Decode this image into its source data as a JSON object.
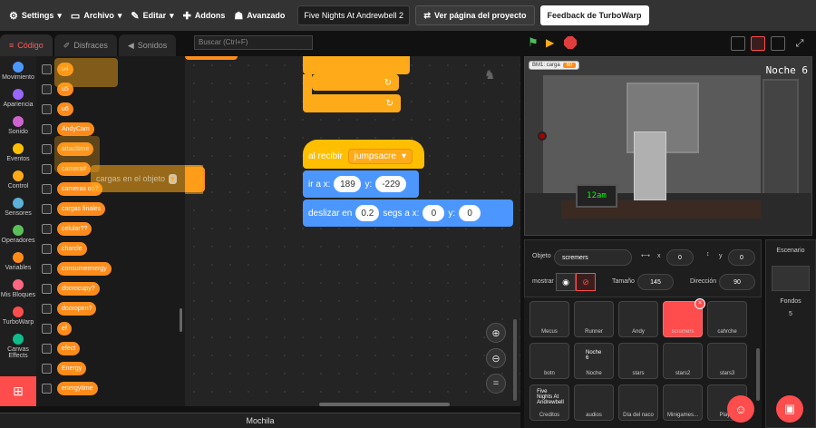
{
  "menubar": {
    "settings": "Settings",
    "archivo": "Archivo",
    "editar": "Editar",
    "addons": "Addons",
    "avanzado": "Avanzado",
    "project_title": "Five  Nights At Andrewbell 2",
    "ver_pagina": "Ver página del proyecto",
    "feedback": "Feedback de TurboWarp"
  },
  "tabs": {
    "codigo": "Código",
    "disfraces": "Disfraces",
    "sonidos": "Sonidos"
  },
  "search": {
    "placeholder": "Buscar (Ctrl+F)"
  },
  "categories": [
    {
      "label": "Movimiento",
      "color": "#4c97ff"
    },
    {
      "label": "Apariencia",
      "color": "#9966ff"
    },
    {
      "label": "Sonido",
      "color": "#cf63cf"
    },
    {
      "label": "Eventos",
      "color": "#ffbf00"
    },
    {
      "label": "Control",
      "color": "#ffab19"
    },
    {
      "label": "Sensores",
      "color": "#5cb1d6"
    },
    {
      "label": "Operadores",
      "color": "#59c059"
    },
    {
      "label": "Variables",
      "color": "#ff8c1a"
    },
    {
      "label": "Mis Bloques",
      "color": "#ff6680"
    },
    {
      "label": "TurboWarp",
      "color": "#ff4c4c"
    },
    {
      "label": "Canvas Effects",
      "color": "#0fbd8c"
    }
  ],
  "variables": [
    "u4",
    "u5",
    "u6",
    "AndyCam",
    "attacttime",
    "camera#",
    "cameras on?",
    "cargas finales",
    "celular??",
    "charcle",
    "consumeenergy",
    "doorocupy?",
    "dooropen?",
    "ef",
    "efect",
    "Energy",
    "energytime"
  ],
  "workspace": {
    "hat_label": "al recibir",
    "hat_message": "jumpsacre",
    "goto_label": "ir a x:",
    "goto_x": "189",
    "goto_y_label": "y:",
    "goto_y": "-229",
    "glide_label": "deslizar en",
    "glide_secs": "0.2",
    "glide_mid": "segs a x:",
    "glide_x": "0",
    "glide_y_label": "y:",
    "glide_y": "0",
    "ghost_text": "cargas en el objeto"
  },
  "mochila": "Mochila",
  "stage": {
    "monitor_label": "BM1: carga",
    "monitor_value": "60",
    "night": "Noche 6",
    "clock": "12am"
  },
  "sprite_info": {
    "objeto_label": "Objeto",
    "objeto": "scremers",
    "x_label": "x",
    "x": "0",
    "y_label": "y",
    "y": "0",
    "mostrar_label": "mostrar",
    "tamano_label": "Tamaño",
    "tamano": "145",
    "direccion_label": "Dirección",
    "direccion": "90"
  },
  "sprites": [
    {
      "name": "Mecus",
      "thumb": ""
    },
    {
      "name": "Runner",
      "thumb": ""
    },
    {
      "name": "Andy",
      "thumb": ""
    },
    {
      "name": "scremers",
      "thumb": ""
    },
    {
      "name": "cahrche",
      "thumb": ""
    },
    {
      "name": "botn",
      "thumb": ""
    },
    {
      "name": "Noche",
      "thumb": "Noche 6"
    },
    {
      "name": "stars",
      "thumb": ""
    },
    {
      "name": "stars2",
      "thumb": ""
    },
    {
      "name": "stars3",
      "thumb": ""
    },
    {
      "name": "Creditos",
      "thumb": "Five Nights At Andrewbell"
    },
    {
      "name": "audios",
      "thumb": ""
    },
    {
      "name": "Día del naco",
      "thumb": ""
    },
    {
      "name": "Minigames...",
      "thumb": ""
    },
    {
      "name": "Player",
      "thumb": ""
    }
  ],
  "escenario": {
    "title": "Escenario",
    "fondos_label": "Fondos",
    "fondos": "5"
  }
}
